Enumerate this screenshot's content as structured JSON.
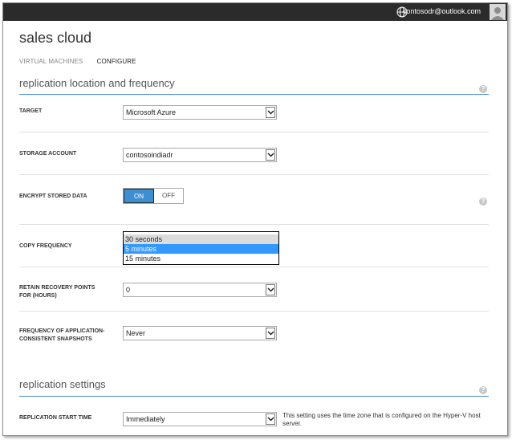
{
  "topbar": {
    "email": "contosodr@outlook.com"
  },
  "page": {
    "title": "sales cloud"
  },
  "nav": {
    "items": [
      {
        "label": "VIRTUAL MACHINES"
      },
      {
        "label": "CONFIGURE"
      }
    ]
  },
  "sections": {
    "location": {
      "title": "replication location and frequency"
    },
    "settings": {
      "title": "replication settings"
    }
  },
  "help_icon": "?",
  "fields": {
    "target": {
      "label": "TARGET",
      "value": "Microsoft Azure"
    },
    "storage": {
      "label": "STORAGE ACCOUNT",
      "value": "contosoindiadr"
    },
    "encrypt": {
      "label": "ENCRYPT STORED DATA",
      "on": "ON",
      "off": "OFF",
      "selected": "ON"
    },
    "copy_frequency": {
      "label": "COPY FREQUENCY",
      "options": [
        "30 seconds",
        "5 minutes",
        "15 minutes"
      ],
      "selected": "5 minutes"
    },
    "retain": {
      "label": "RETAIN RECOVERY POINTS FOR (HOURS)",
      "value": "0"
    },
    "snapshots": {
      "label": "FREQUENCY OF APPLICATION-CONSISTENT SNAPSHOTS",
      "value": "Never"
    },
    "start_time": {
      "label": "REPLICATION START TIME",
      "value": "Immediately",
      "note": "This setting uses the time zone that is configured on the Hyper-V host server."
    }
  },
  "colors": {
    "accent": "#3d8fd1",
    "topbar": "#2b2b2b",
    "selection": "#3399ff"
  },
  "icons": {
    "globe": "globe-icon",
    "avatar": "avatar-icon",
    "help": "help-icon",
    "dropdown": "chevron-down-icon"
  }
}
